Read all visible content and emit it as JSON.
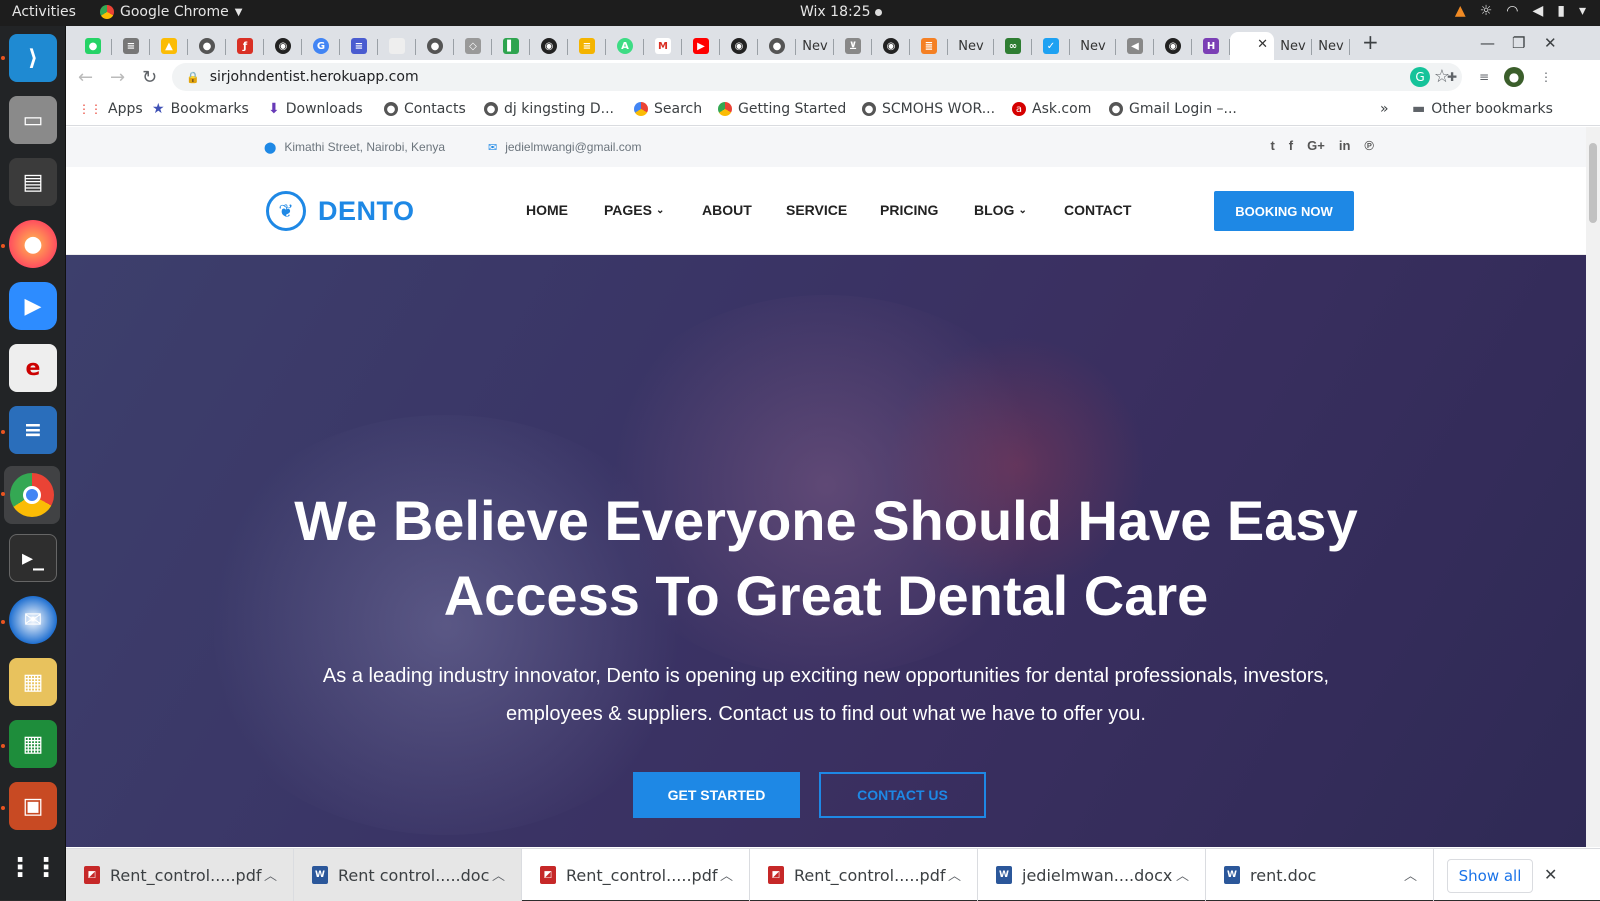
{
  "os": {
    "activities": "Activities",
    "app_name": "Google Chrome",
    "clock": "Wix 18:25"
  },
  "browser": {
    "tab_labels": [
      "Nev",
      "Nev",
      "Nev",
      "Nev",
      "Nev"
    ],
    "url": "sirjohndentist.herokuapp.com",
    "bookmarks": [
      "Apps",
      "Bookmarks",
      "Downloads",
      "Contacts",
      "dj kingsting D...",
      "Search",
      "Getting Started",
      "SCMOHS WOR...",
      "Ask.com",
      "Gmail Login –..."
    ],
    "more_bookmarks": "»",
    "other_bookmarks": "Other bookmarks"
  },
  "site": {
    "address": "Kimathi Street, Nairobi, Kenya",
    "email": "jedielmwangi@gmail.com",
    "brand": "DENTO",
    "nav": [
      "HOME",
      "PAGES",
      "ABOUT",
      "SERVICE",
      "PRICING",
      "BLOG",
      "CONTACT"
    ],
    "booking_label": "BOOKING NOW",
    "hero": {
      "title": "We Believe Everyone Should Have Easy Access To Great Dental Care",
      "subtitle": "As a leading industry innovator, Dento is opening up exciting new opportunities for dental professionals, investors, employees & suppliers. Contact us to find out what we have to offer you.",
      "primary_cta": "GET STARTED",
      "secondary_cta": "CONTACT US"
    },
    "brand_color": "#1e88e5"
  },
  "downloads": {
    "files": [
      "Rent_control.....pdf",
      "Rent control.....doc",
      "Rent_control.....pdf",
      "Rent_control.....pdf",
      "jedielmwan....docx",
      "rent.doc"
    ],
    "show_all": "Show all"
  }
}
